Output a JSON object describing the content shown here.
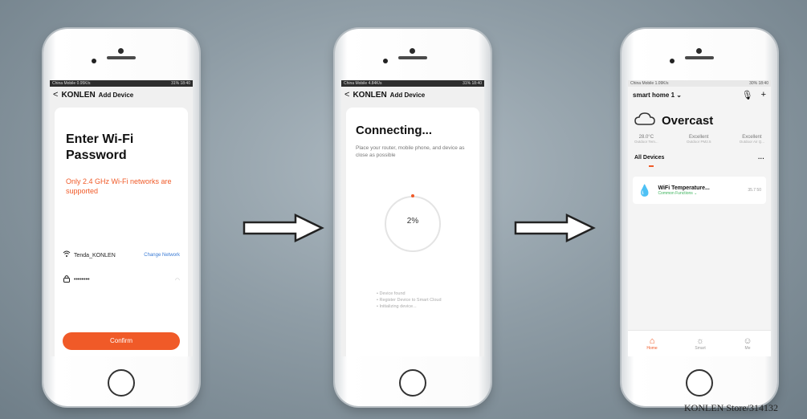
{
  "phone1": {
    "status_left": "China Mobile 0.95K/s",
    "status_right": "31% 18:40",
    "nav_back": "<",
    "nav_brand": "KONLEN",
    "nav_title": "Add Device",
    "heading": "Enter Wi-Fi Password",
    "warning": "Only 2.4 GHz Wi-Fi networks are supported",
    "wifi_name": "Tenda_KONLEN",
    "change_network": "Change Network",
    "password_value": "••••••••",
    "confirm_label": "Confirm"
  },
  "phone2": {
    "status_left": "China Mobile 4.84K/s",
    "status_right": "31% 18:40",
    "nav_back": "<",
    "nav_brand": "KONLEN",
    "nav_title": "Add Device",
    "heading": "Connecting...",
    "description": "Place your router, mobile phone, and device as close as possible",
    "progress_text": "2%",
    "progress": 0.02,
    "steps": [
      "Device found",
      "Register Device to Smart Cloud",
      "Initializing device..."
    ]
  },
  "phone3": {
    "status_left": "China Mobile 1.09K/s",
    "status_right": "30% 18:40",
    "home_name": "smart home 1",
    "weather": "Overcast",
    "stats": [
      {
        "value": "28.0°C",
        "label": "Outdoor Tem..."
      },
      {
        "value": "Excellent",
        "label": "Outdoor PM2.5"
      },
      {
        "value": "Excellent",
        "label": "Outdoor Air Q..."
      }
    ],
    "devices_label": "All Devices",
    "more_label": "···",
    "device_name": "WiFi Temperature...",
    "device_sub": "Common Functions",
    "device_values": "35.7  50",
    "tabs": [
      {
        "label": "Home",
        "icon": "home-icon"
      },
      {
        "label": "Smart",
        "icon": "sun-icon"
      },
      {
        "label": "Me",
        "icon": "profile-icon"
      }
    ]
  },
  "watermark": "KONLEN Store/314132",
  "colors": {
    "accent": "#f05a28",
    "link": "#3a7bd5",
    "success": "#3bb35a"
  }
}
